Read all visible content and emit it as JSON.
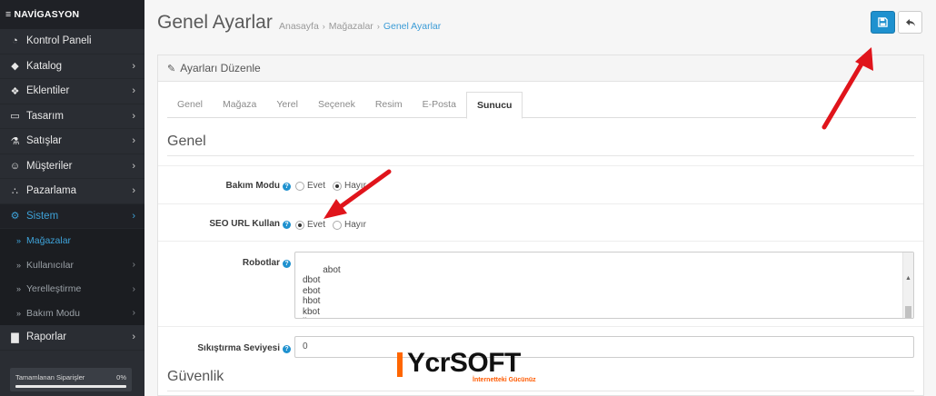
{
  "sidebar": {
    "header": "≡ NAVİGASYON",
    "items": [
      {
        "label": "Kontrol Paneli",
        "icon": "dashboard-icon",
        "glyph": "◔",
        "chevron": ""
      },
      {
        "label": "Katalog",
        "icon": "tag-icon",
        "glyph": "◆",
        "chevron": "›"
      },
      {
        "label": "Eklentiler",
        "icon": "puzzle-icon",
        "glyph": "❖",
        "chevron": "›"
      },
      {
        "label": "Tasarım",
        "icon": "desktop-icon",
        "glyph": "▭",
        "chevron": "›"
      },
      {
        "label": "Satışlar",
        "icon": "cart-icon",
        "glyph": "⚗",
        "chevron": "›"
      },
      {
        "label": "Müşteriler",
        "icon": "user-icon",
        "glyph": "☺",
        "chevron": "›"
      },
      {
        "label": "Pazarlama",
        "icon": "share-icon",
        "glyph": "∴",
        "chevron": "›"
      },
      {
        "label": "Sistem",
        "icon": "gear-icon",
        "glyph": "⚙",
        "chevron": "›"
      }
    ],
    "subitems": [
      {
        "label": "Mağazalar",
        "chevron": ""
      },
      {
        "label": "Kullanıcılar",
        "chevron": "›"
      },
      {
        "label": "Yerelleştirme",
        "chevron": "›"
      },
      {
        "label": "Bakım Modu",
        "chevron": "›"
      }
    ],
    "reports": {
      "label": "Raporlar",
      "icon": "bar-chart-icon",
      "glyph": "▇",
      "chevron": "›"
    },
    "progress": {
      "label": "Tamamlanan Siparişler",
      "value": "0%",
      "fraction": 0
    }
  },
  "header": {
    "title": "Genel Ayarlar",
    "breadcrumb": [
      "Anasayfa",
      "Mağazalar",
      "Genel Ayarlar"
    ],
    "breadcrumb_sep": "›"
  },
  "panel": {
    "heading": "Ayarları Düzenle",
    "tabs": [
      "Genel",
      "Mağaza",
      "Yerel",
      "Seçenek",
      "Resim",
      "E-Posta",
      "Sunucu"
    ],
    "active_tab": "Sunucu",
    "legend_general": "Genel",
    "legend_security": "Güvenlik",
    "maintenance": {
      "label": "Bakım Modu",
      "yes": "Evet",
      "no": "Hayır",
      "selected": "no"
    },
    "seo": {
      "label": "SEO URL Kullan",
      "yes": "Evet",
      "no": "Hayır",
      "selected": "yes"
    },
    "robots": {
      "label": "Robotlar",
      "value": "abot\ndbot\nebot\nhbot\nkbot\nlbot"
    },
    "compression": {
      "label": "Sıkıştırma Seviyesi",
      "value": "0"
    },
    "help_glyph": "?"
  },
  "watermark": {
    "brand": "YcrSOFT",
    "tagline": "İnternetteki Gücünüz"
  },
  "colors": {
    "accent": "#1e91cf",
    "sidebar_bg": "#2a2d33",
    "arrow": "#e0141b",
    "brand_orange": "#ff6600"
  }
}
